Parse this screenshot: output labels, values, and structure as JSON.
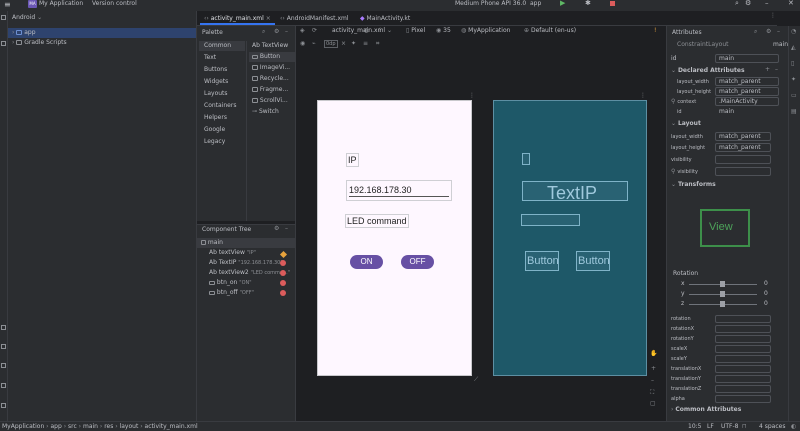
{
  "titlebar": {
    "app_badge": "MA",
    "project": "My Application",
    "vcs": "Version control",
    "device": "Medium Phone API 36.0",
    "run_config": "app"
  },
  "editor_tabs": [
    "activity_main.xml",
    "AndroidManifest.xml",
    "MainActivity.kt"
  ],
  "project_panel": {
    "view_mode": "Android",
    "items": [
      "app",
      "Gradle Scripts"
    ]
  },
  "palette": {
    "title": "Palette",
    "categories": [
      "Common",
      "Text",
      "Buttons",
      "Widgets",
      "Layouts",
      "Containers",
      "Helpers",
      "Google",
      "Legacy"
    ],
    "items": [
      "Ab TextView",
      "Button",
      "ImageVi...",
      "Recycle...",
      "Fragme...",
      "ScrollVi...",
      "Switch"
    ]
  },
  "design_toolbar": {
    "file": "activity_main.xml",
    "device": "Pixel",
    "api": "35",
    "theme": "MyApplication",
    "locale": "Default (en-us)",
    "margin": "0dp"
  },
  "component_tree": {
    "title": "Component Tree",
    "root": "main",
    "items": [
      {
        "label": "Ab textView",
        "hint": "\"IP\"",
        "status": "warn"
      },
      {
        "label": "Ab TextIP",
        "hint": "\"192.168.178.30\"",
        "status": "err"
      },
      {
        "label": "Ab textView2",
        "hint": "\"LED comma...\"",
        "status": "err"
      },
      {
        "label": "btn_on",
        "hint": "\"ON\"",
        "status": "err"
      },
      {
        "label": "btn_off",
        "hint": "\"OFF\"",
        "status": "err"
      }
    ]
  },
  "phone_preview": {
    "label_ip": "IP",
    "ip_value": "192.168.178.30",
    "label_led": "LED command",
    "btn_on": "ON",
    "btn_off": "OFF"
  },
  "blueprint": {
    "textip": "TextIP",
    "button1": "Button",
    "button2": "Button"
  },
  "attributes": {
    "title": "Attributes",
    "class_name": "ConstraintLayout",
    "root_name": "main",
    "id_label": "id",
    "id_value": "main",
    "declared_title": "Declared Attributes",
    "declared": [
      {
        "name": "layout_width",
        "value": "match_parent"
      },
      {
        "name": "layout_height",
        "value": "match_parent"
      },
      {
        "name": "context",
        "value": ".MainActivity"
      },
      {
        "name": "id",
        "value": "main"
      }
    ],
    "layout_title": "Layout",
    "layout": [
      {
        "name": "layout_width",
        "value": "match_parent"
      },
      {
        "name": "layout_height",
        "value": "match_parent"
      },
      {
        "name": "visibility",
        "value": ""
      },
      {
        "name": "visibility",
        "value": ""
      }
    ],
    "transforms_title": "Transforms",
    "view_label": "View",
    "rotation_label": "Rotation",
    "axes": [
      {
        "name": "x",
        "value": "0"
      },
      {
        "name": "y",
        "value": "0"
      },
      {
        "name": "z",
        "value": "0"
      }
    ],
    "props": [
      "rotation",
      "rotationX",
      "rotationY",
      "scaleX",
      "scaleY",
      "translationX",
      "translationY",
      "translationZ",
      "alpha"
    ],
    "common_title": "Common Attributes"
  },
  "statusbar": {
    "breadcrumb": [
      "MyApplication",
      "app",
      "src",
      "main",
      "res",
      "layout",
      "activity_main.xml"
    ],
    "position": "10:5",
    "line_sep": "LF",
    "encoding": "UTF-8",
    "indent": "4 spaces"
  }
}
